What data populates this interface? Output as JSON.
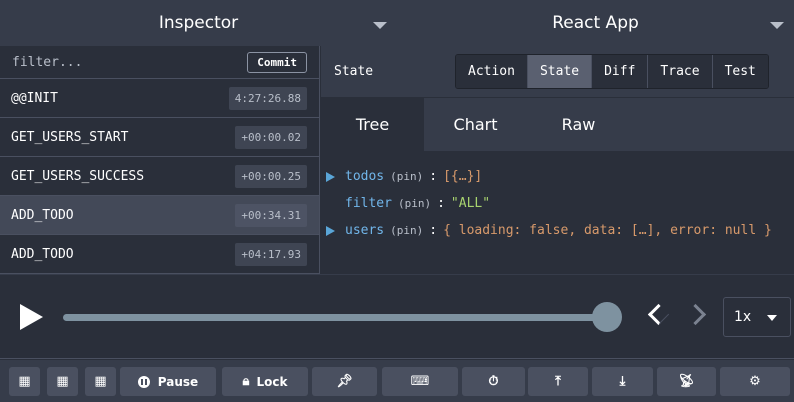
{
  "topbar": {
    "left_select": "Inspector",
    "right_select": "React App"
  },
  "filter": {
    "placeholder": "filter...",
    "value": "",
    "commit_label": "Commit"
  },
  "actions": [
    {
      "name": "@@INIT",
      "time": "4:27:26.88",
      "selected": false
    },
    {
      "name": "GET_USERS_START",
      "time": "+00:00.02",
      "selected": false
    },
    {
      "name": "GET_USERS_SUCCESS",
      "time": "+00:00.25",
      "selected": false
    },
    {
      "name": "ADD_TODO",
      "time": "+00:34.31",
      "selected": true
    },
    {
      "name": "ADD_TODO",
      "time": "+04:17.93",
      "selected": false
    }
  ],
  "right": {
    "title": "State",
    "tabs": [
      "Action",
      "State",
      "Diff",
      "Trace",
      "Test"
    ],
    "active_tab": "State",
    "subtabs": [
      "Tree",
      "Chart",
      "Raw"
    ],
    "active_subtab": "Tree"
  },
  "tree": [
    {
      "key": "todos",
      "pin": "(pin)",
      "value": "[{…}]",
      "type": "obj",
      "expandable": true
    },
    {
      "key": "filter",
      "pin": "(pin)",
      "value": "\"ALL\"",
      "type": "str",
      "expandable": false
    },
    {
      "key": "users",
      "pin": "(pin)",
      "value": "{ loading: false, data: […], error: null }",
      "type": "obj",
      "expandable": true
    }
  ],
  "player": {
    "progress": 1.0,
    "speed": "1x"
  },
  "toolbar": {
    "pause_label": "Pause",
    "lock_label": "Lock"
  },
  "icons": {
    "layout_1": "dock-left-icon",
    "layout_2": "dock-right-icon",
    "layout_3": "dock-bottom-icon",
    "pin": "pin-icon",
    "keyboard": "keyboard-icon",
    "timer": "timer-off-icon",
    "upload": "upload-icon",
    "download": "download-icon",
    "remote": "remote-icon",
    "settings": "gear-icon"
  }
}
